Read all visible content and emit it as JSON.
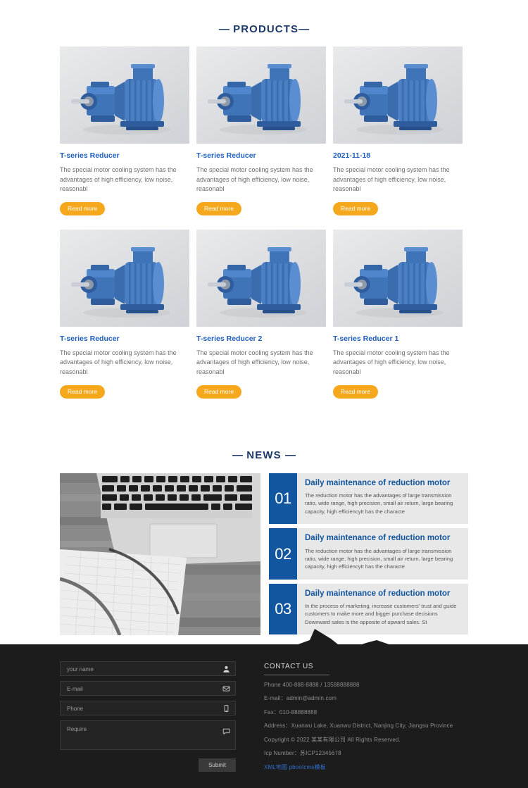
{
  "products_section": {
    "heading": "PRODUCTS",
    "dash_left": "—",
    "dash_right": "—",
    "read_more_label": "Read more",
    "items": [
      {
        "title": "T-series Reducer",
        "desc": "The special motor cooling system has the advantages of high efficiency, low noise, reasonabl ",
        "button": "Read more"
      },
      {
        "title": "T-series Reducer",
        "desc": "The special motor cooling system has the advantages of high efficiency, low noise, reasonabl ",
        "button": "Read more"
      },
      {
        "title": "2021-11-18",
        "desc": "The special motor cooling system has the advantages of high efficiency, low noise, reasonabl ",
        "button": "Read more"
      },
      {
        "title": "T-series Reducer",
        "desc": "The special motor cooling system has the advantages of high efficiency, low noise, reasonabl ",
        "button": "Read more"
      },
      {
        "title": "T-series Reducer 2",
        "desc": "The special motor cooling system has the advantages of high efficiency, low noise, reasonabl ",
        "button": "Read more"
      },
      {
        "title": "T-series Reducer 1",
        "desc": "The special motor cooling system has the advantages of high efficiency, low noise, reasonabl ",
        "button": "Read more"
      }
    ]
  },
  "news_section": {
    "heading": "NEWS",
    "dash_left": "—",
    "dash_right": "—",
    "photo_alt": "laptop-keyboard-notebook-photo",
    "items": [
      {
        "number": "01",
        "title": "Daily maintenance of reduction motor",
        "desc": "The reduction motor has the advantages of large transmission ratio, wide range, high precision, small air return, large bearing capacity, high efficiencyIt has the characte "
      },
      {
        "number": "02",
        "title": "Daily maintenance of reduction motor",
        "desc": "The reduction motor has the advantages of large transmission ratio, wide range, high precision, small air return, large bearing capacity, high efficiencyIt has the characte "
      },
      {
        "number": "03",
        "title": "Daily maintenance of reduction motor",
        "desc": "In the process of marketing, increase customers' trust and guide customers to make more and bigger purchase decisions Downward sales is the opposite of upward sales. St "
      }
    ]
  },
  "footer": {
    "form": {
      "name_placeholder": "your name",
      "email_placeholder": "E-mail",
      "phone_placeholder": "Phone",
      "require_placeholder": "Require",
      "name_value": "",
      "email_value": "",
      "phone_value": "",
      "require_value": "",
      "submit_label": "Submit"
    },
    "contact": {
      "heading": "CONTACT US",
      "phone": "Phone 400-888-8888 / 13588888888",
      "email": "E-mail：admin@admin.com",
      "fax": "Fax：010-88888888",
      "address": "Address：Xuanwu Lake, Xuanwu District, Nanjing City, Jiangsu Province",
      "copyright": "Copyright © 2022 某某有限公司 All Rights Reserved.",
      "icp": "Icp Number：苏ICP12345678",
      "bottom_link": "XML地图 pbootcms模板"
    }
  },
  "colors": {
    "heading_blue": "#1b3a6b",
    "product_title_blue": "#1f5fbf",
    "news_blue": "#1256a0",
    "button_orange": "#f5a81c",
    "footer_dark": "#1c1c1c",
    "link_blue": "#2f6fd0"
  }
}
